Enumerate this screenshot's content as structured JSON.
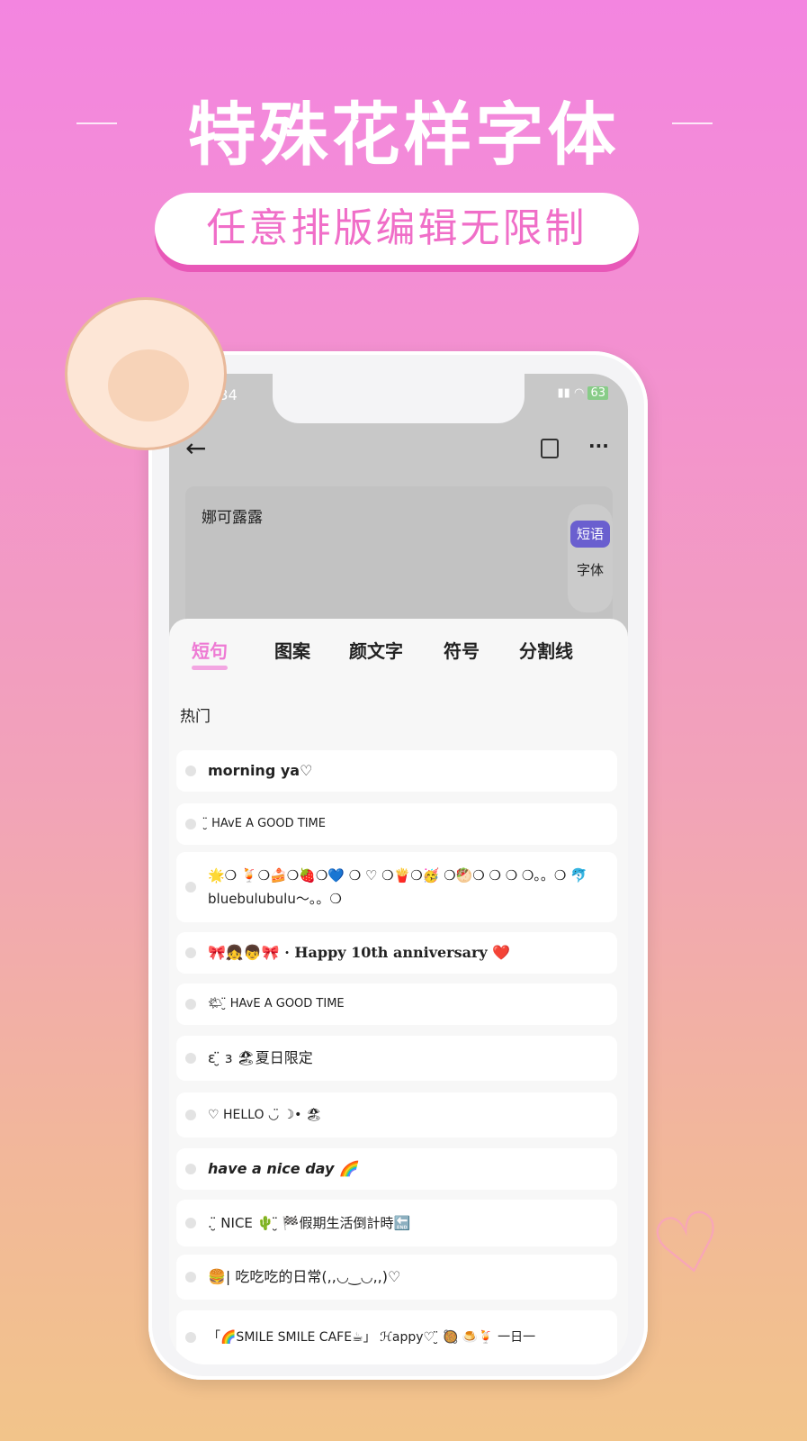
{
  "promo": {
    "headline": "特殊花样字体",
    "subtitle": "任意排版编辑无限制"
  },
  "status_bar": {
    "time": ":34",
    "battery": "63"
  },
  "editor": {
    "text": "娜可露露",
    "modes": [
      "短语",
      "字体"
    ],
    "active_mode": "短语"
  },
  "tabs": [
    "短句",
    "图案",
    "颜文字",
    "符号",
    "分割线"
  ],
  "active_tab": "短句",
  "section_label": "热门",
  "phrases": [
    "morning ya♡",
    "̮̈ HAvE A GOOD TIME",
    "🌟❍ 🍹❍🍰❍🍓❍💙 ❍ ♡ ❍🍟❍🥳 ❍🥙❍ ❍ ❍ ❍。。❍ 🐬 bluebulubulu～。。❍",
    "🎀👧👦🎀 · Happy 10th anniversary ❤️",
    "🌤 ̮̈ HAvE A GOOD TIME",
    "ε ̮̈ з 🏖夏日限定",
    "♡ HELLO ◡̈ ☽• 🏖",
    "have a nice day 🌈",
    ". ̮̈ NICE 🌵 ̮̈ 🏁假期生活倒計時🔚",
    "🍔| 吃吃吃的日常(,,◡‿◡,,)♡",
    "「🌈SMILE SMILE CAFE☕」 ℋappy♡ ̮̈ 🥘 🍮🍹 一日一"
  ],
  "colors": {
    "accent": "#ee7ad4",
    "mode_active": "#6a5fcf"
  }
}
